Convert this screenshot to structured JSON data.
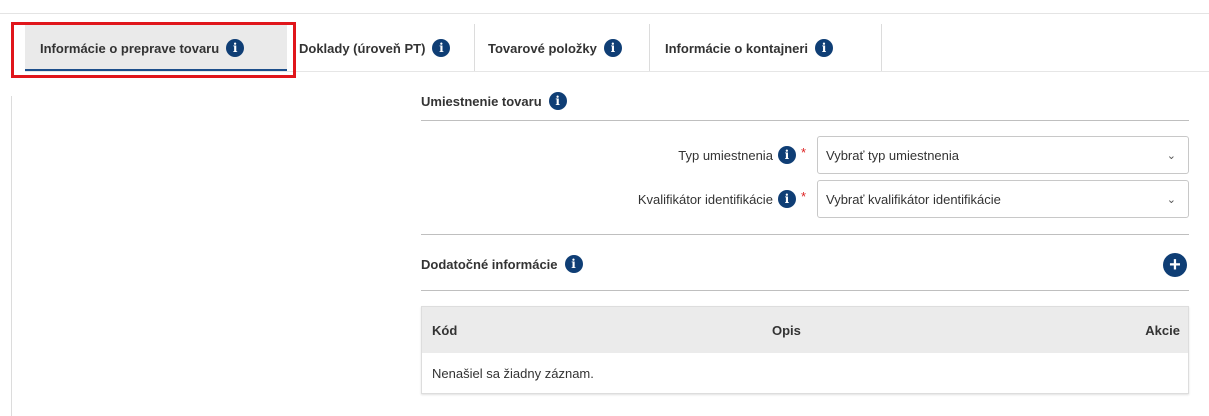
{
  "tabs": [
    {
      "label": "Informácie o preprave tovaru",
      "active": true
    },
    {
      "label": "Doklady (úroveň PT)",
      "active": false
    },
    {
      "label": "Tovarové položky",
      "active": false
    },
    {
      "label": "Informácie o kontajneri",
      "active": false
    }
  ],
  "goods_location": {
    "title": "Umiestnenie tovaru",
    "location_type": {
      "label": "Typ umiestnenia",
      "required_mark": "*",
      "placeholder": "Vybrať typ umiestnenia"
    },
    "identification_qualifier": {
      "label": "Kvalifikátor identifikácie",
      "required_mark": "*",
      "placeholder": "Vybrať kvalifikátor identifikácie"
    }
  },
  "additional_info": {
    "title": "Dodatočné informácie",
    "table": {
      "columns": [
        "Kód",
        "Opis",
        "Akcie"
      ],
      "empty_message": "Nenašiel sa žiadny záznam."
    }
  },
  "icons": {
    "info": "info-circle-icon",
    "add": "plus-circle-icon",
    "dropdown": "chevron-down-icon"
  },
  "colors": {
    "accent": "#0f3e75",
    "active_tab_underline": "#1d4f8b",
    "highlight_border": "#e0161b",
    "required": "#dd2222"
  }
}
